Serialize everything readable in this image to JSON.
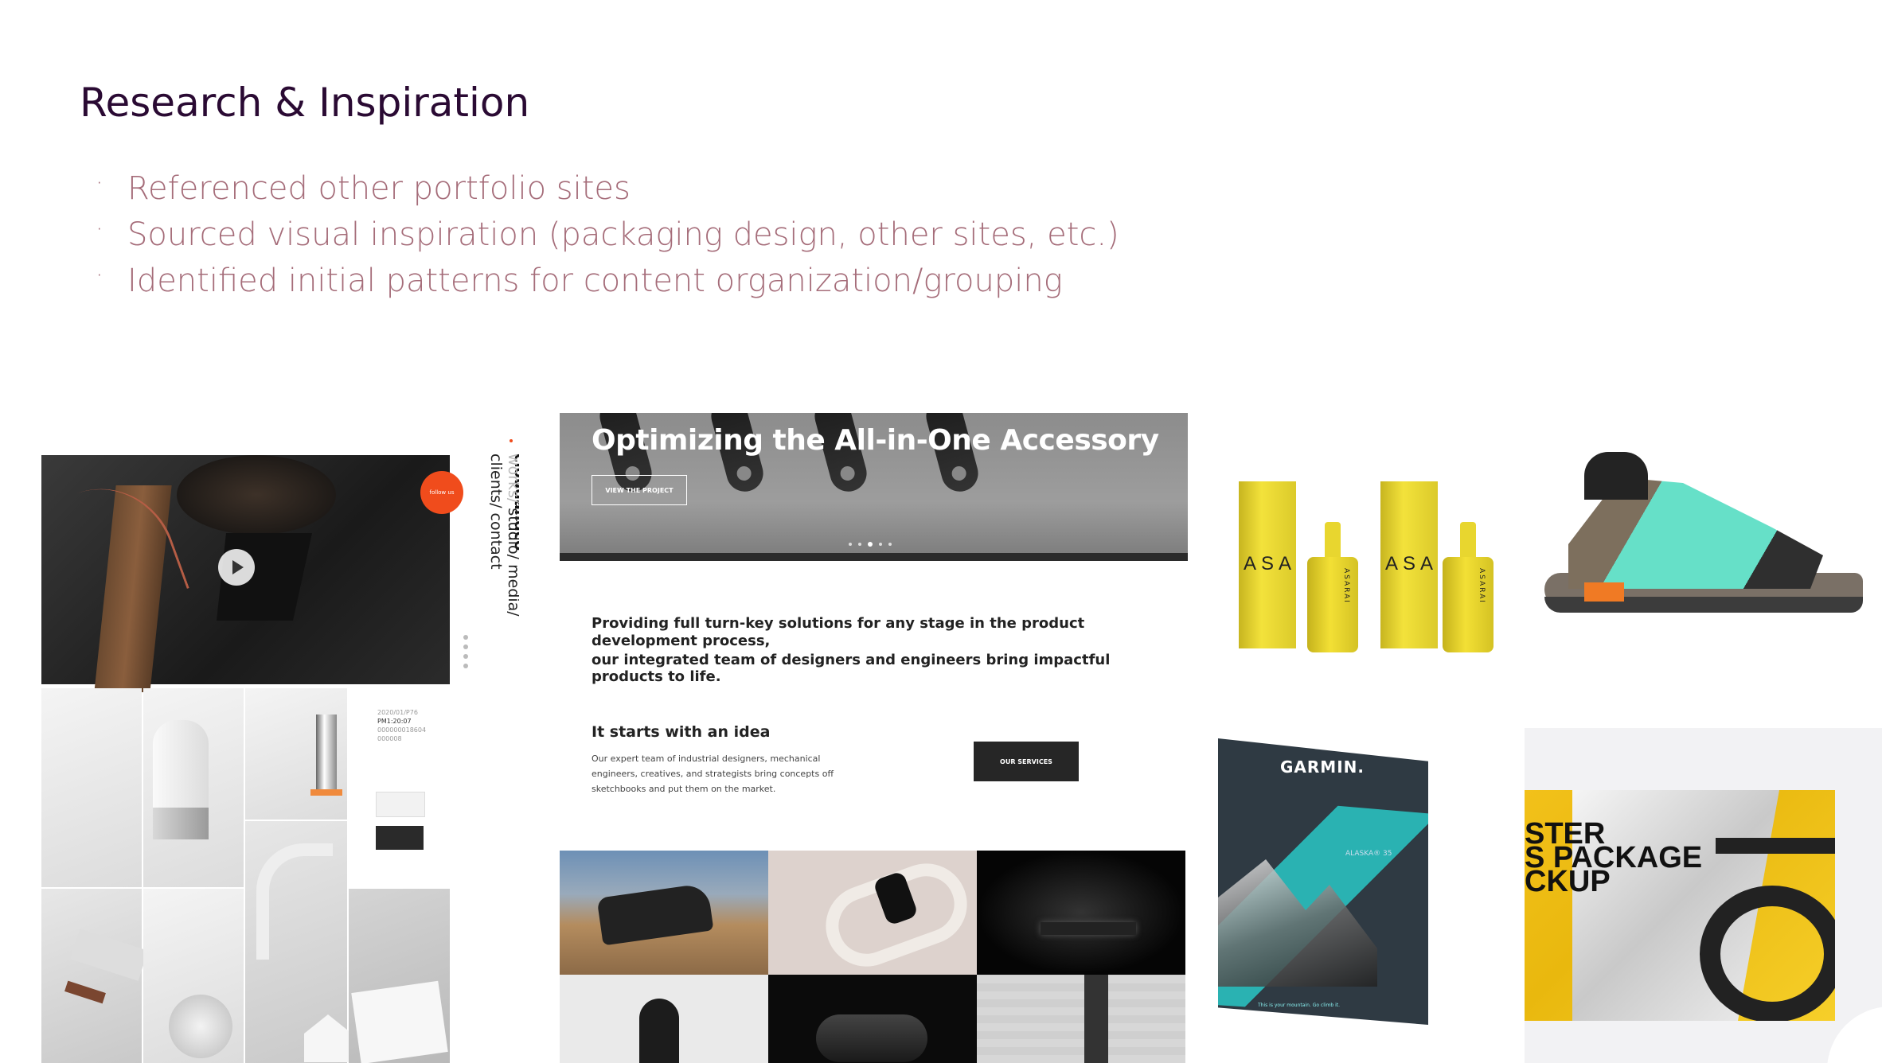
{
  "slide": {
    "title": "Research & Inspiration",
    "bullets": [
      "Referenced other portfolio sites",
      "Sourced visual inspiration (packaging design, other sites, etc.)",
      "Identified initial patterns for content organization/grouping"
    ]
  },
  "cloudandco": {
    "brand": "cloudandco",
    "nav_muted": "works/",
    "nav_rest": " studio/ media/ clients/ contact",
    "follow_label": "follow us",
    "meta": [
      "2020/01/P76",
      "PM1:20:07",
      "000000018604",
      "000008"
    ]
  },
  "optimizing": {
    "hero_title": "Optimizing the All-in-One Accessory",
    "view_button": "VIEW THE PROJECT",
    "tagline_1": "Providing full turn-key solutions for any stage in the product development process,",
    "tagline_2": "our integrated team of designers and engineers bring impactful products to life.",
    "heading": "It starts with an idea",
    "body": "Our expert team of industrial designers, mechanical engineers, creatives, and strategists bring concepts off sketchbooks and put them on the market.",
    "services_button": "OUR SERVICES"
  },
  "asarai": {
    "tube_label": "ASA",
    "bottle_label": "ASARAI"
  },
  "garmin": {
    "logo": "GARMIN.",
    "product": "ALASKA® 35",
    "footer": "This is your mountain. Go climb it."
  },
  "blister": {
    "text": "STER\nS PACKAGE\nCKUP"
  }
}
